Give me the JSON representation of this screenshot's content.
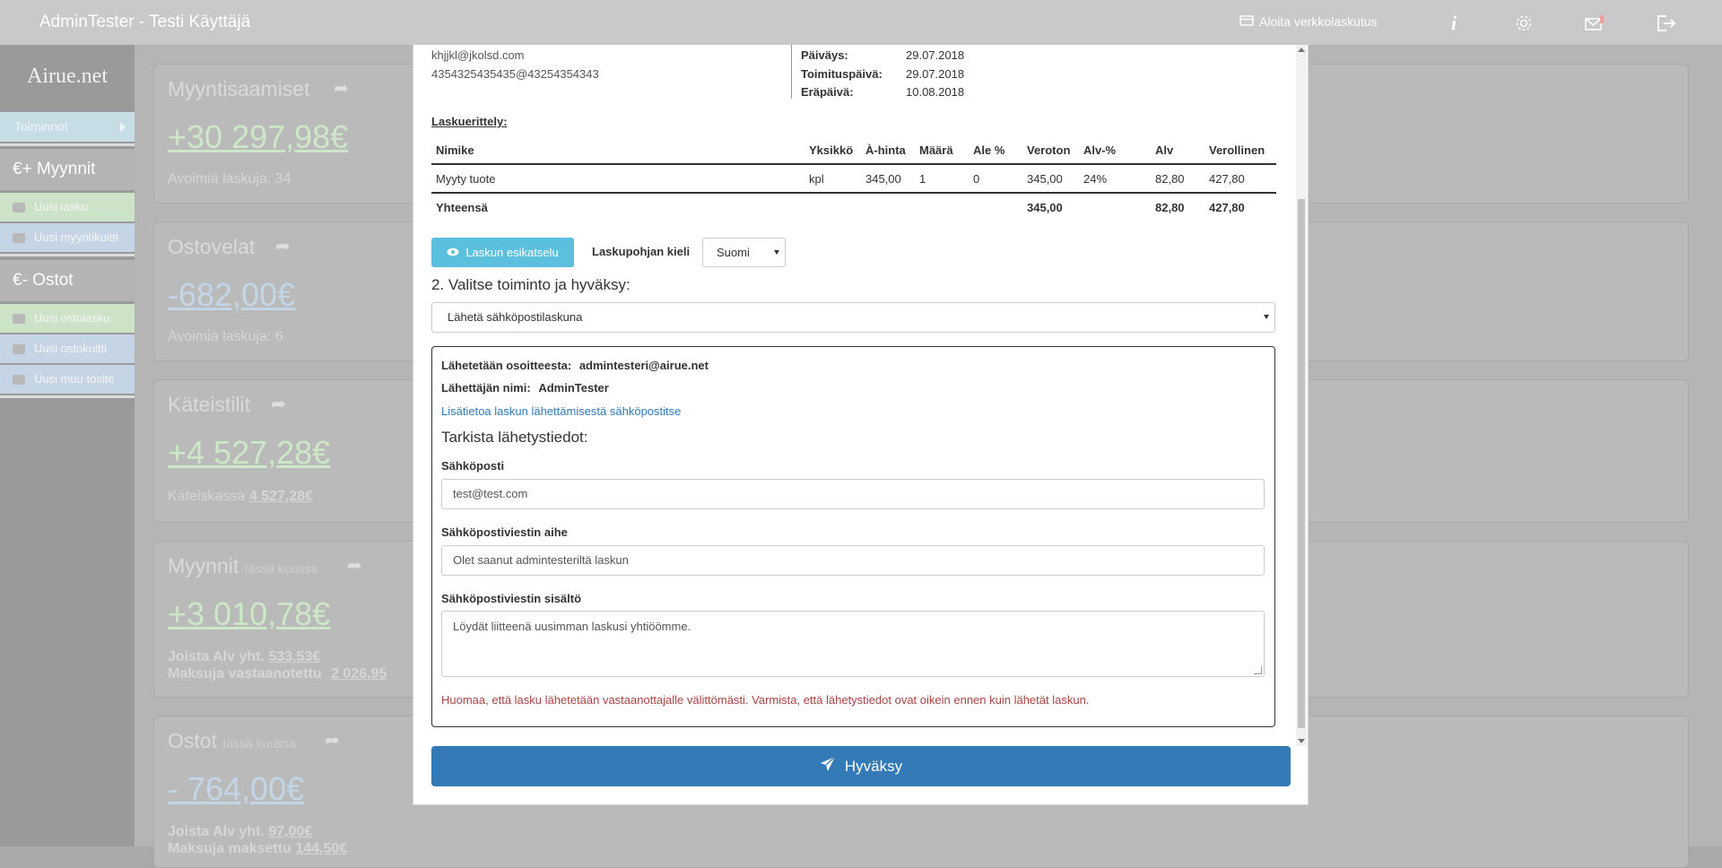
{
  "topbar": {
    "title": "AdminTester - Testi Käyttäjä",
    "action_label": "Aloita verkkolaskutus",
    "icons": [
      "card-icon",
      "info-icon",
      "gear-icon",
      "mail-icon",
      "logout-icon"
    ]
  },
  "sidebar": {
    "logo": "Airue.net",
    "toiminnot": "Toiminnot",
    "sales_header": "€+  Myynnit",
    "sales_items": [
      "Uusi lasku",
      "Uusi myyntikuitti"
    ],
    "purchases_header": "€-  Ostot",
    "purchase_items": [
      "Uusi ostolasku",
      "Uusi ostokuitti",
      "Uusi muu tosite"
    ]
  },
  "dashboard": {
    "receivables": {
      "title": "Myyntisaamiset",
      "amount": "+30 297,98€",
      "sub": "Avoimia laskuja: 34"
    },
    "payables": {
      "title": "Ostovelat",
      "amount": "-682,00€",
      "sub": "Avoimia laskuja: 6"
    },
    "cash": {
      "title": "Käteistilit",
      "amount": "+4 527,28€",
      "sub_label": "Käteiskassa",
      "sub_value": "4 527,28€"
    },
    "sales_month": {
      "title": "Myynnit",
      "title_small": "tässä kuussa",
      "amount": "+3 010,78€",
      "vat_label": "Joista Alv yht.",
      "vat_value": "533,53€",
      "paid_label": "Maksuja vastaanotettu",
      "paid_value": "2 026,95"
    },
    "purchases_month": {
      "title": "Ostot",
      "title_small": "tässä kuussa",
      "amount": "- 764,00€",
      "vat_label": "Joista Alv yht.",
      "vat_value": "97,00€",
      "paid_label": "Maksuja maksettu",
      "paid_value": "144,50€"
    }
  },
  "invoice": {
    "recipient_email": "khjjkl@jkolsd.com",
    "recipient_einvoice": "4354325435435@43254354343",
    "dates": [
      {
        "label": "Päiväys:",
        "value": "29.07.2018"
      },
      {
        "label": "Toimituspäivä:",
        "value": "29.07.2018"
      },
      {
        "label": "Eräpäivä:",
        "value": "10.08.2018"
      }
    ],
    "section_title": "Laskuerittely:",
    "columns": [
      "Nimike",
      "Yksikkö",
      "À-hinta",
      "Määrä",
      "Ale %",
      "Veroton",
      "Alv-%",
      "Alv",
      "Verollinen"
    ],
    "rows": [
      [
        "Myyty tuote",
        "kpl",
        "345,00",
        "1",
        "0",
        "345,00",
        "24%",
        "82,80",
        "427,80"
      ]
    ],
    "total": {
      "label": "Yhteensä",
      "veroton": "345,00",
      "alv": "82,80",
      "verollinen": "427,80"
    }
  },
  "controls": {
    "preview_button": "Laskun esikatselu",
    "lang_label": "Laskupohjan kieli",
    "lang_value": "Suomi",
    "step2_title": "2. Valitse toiminto ja hyväksy:",
    "action_value": "Lähetä sähköpostilaskuna"
  },
  "email_panel": {
    "sender_label": "Lähetetään osoitteesta:",
    "sender_value": "admintesteri@airue.net",
    "sender_name_label": "Lähettäjän nimi:",
    "sender_name_value": "AdminTester",
    "info_link": "Lisätietoa laskun lähettämisestä sähköpostitse",
    "check_title": "Tarkista lähetystiedot:",
    "email_label": "Sähköposti",
    "email_value": "test@test.com",
    "subject_label": "Sähköpostiviestin aihe",
    "subject_value": "Olet saanut admintesteriltä laskun",
    "body_label": "Sähköpostiviestin sisältö",
    "body_value": "Löydät liitteenä uusimman laskusi yhtiöömme.",
    "warning": "Huomaa, että lasku lähetetään vastaanottajalle välittömästi. Varmista, että lähetystiedot ovat oikein ennen kuin lähetät laskun."
  },
  "approve_button": "Hyväksy"
}
